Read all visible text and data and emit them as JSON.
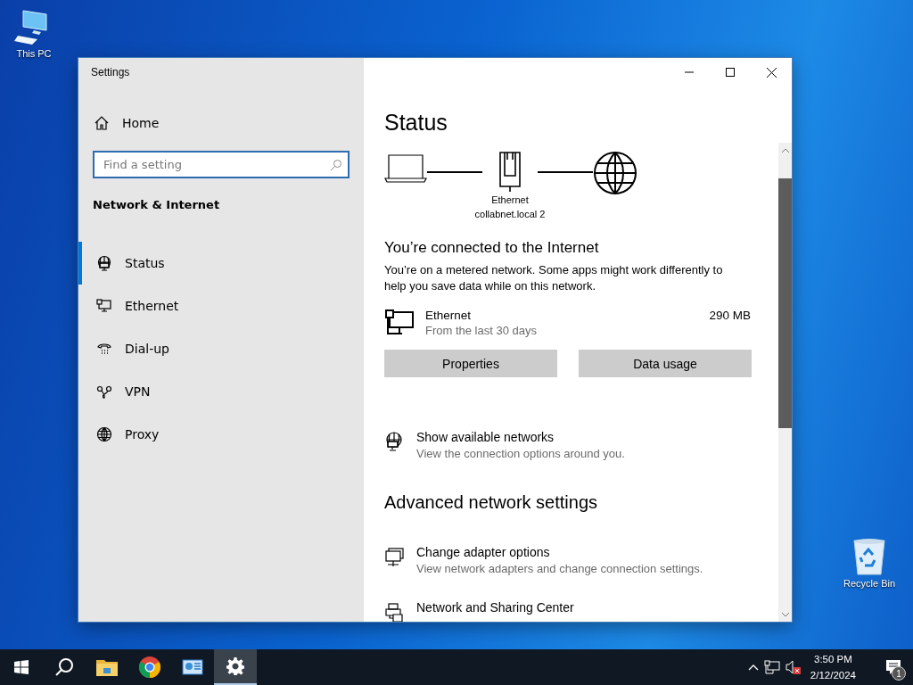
{
  "desktop_icons": [
    {
      "kind": "pc",
      "label": "This PC"
    },
    {
      "kind": "bin",
      "label": "Recycle Bin"
    }
  ],
  "window": {
    "title": "Settings"
  },
  "sidebar": {
    "home": "Home",
    "search": {
      "placeholder": "Find a setting"
    },
    "section": "Network & Internet",
    "items": [
      {
        "kind": "status",
        "label": "Status",
        "selected": true
      },
      {
        "kind": "ethernet",
        "label": "Ethernet",
        "selected": false
      },
      {
        "kind": "dialup",
        "label": "Dial-up",
        "selected": false
      },
      {
        "kind": "vpn",
        "label": "VPN",
        "selected": false
      },
      {
        "kind": "proxy",
        "label": "Proxy",
        "selected": false
      }
    ]
  },
  "content": {
    "title": "Status",
    "diagram": {
      "adapter": "Ethernet",
      "network": "collabnet.local 2"
    },
    "heading": "You’re connected to the Internet",
    "description": "You’re on a metered network. Some apps might work differently to help you save data while on this network.",
    "usage": {
      "name": "Ethernet",
      "period": "From the last 30 days",
      "amount": "290 MB"
    },
    "buttons": [
      "Properties",
      "Data usage"
    ],
    "links": [
      {
        "kind": "networks",
        "title": "Show available networks",
        "subtitle": "View the connection options around you."
      }
    ],
    "advanced_heading": "Advanced network settings",
    "advanced_links": [
      {
        "kind": "adapter",
        "title": "Change adapter options",
        "subtitle": "View network adapters and change connection settings."
      },
      {
        "kind": "sharing",
        "title": "Network and Sharing Center"
      }
    ]
  },
  "taskbar": {
    "apps": [
      {
        "kind": "start",
        "selected": false
      },
      {
        "kind": "search",
        "selected": false
      },
      {
        "kind": "explorer",
        "selected": false
      },
      {
        "kind": "chrome",
        "selected": false
      },
      {
        "kind": "panel",
        "selected": false
      },
      {
        "kind": "settings",
        "selected": true
      }
    ],
    "time": "3:50 PM",
    "date": "2/12/2024",
    "notifications": "1"
  }
}
